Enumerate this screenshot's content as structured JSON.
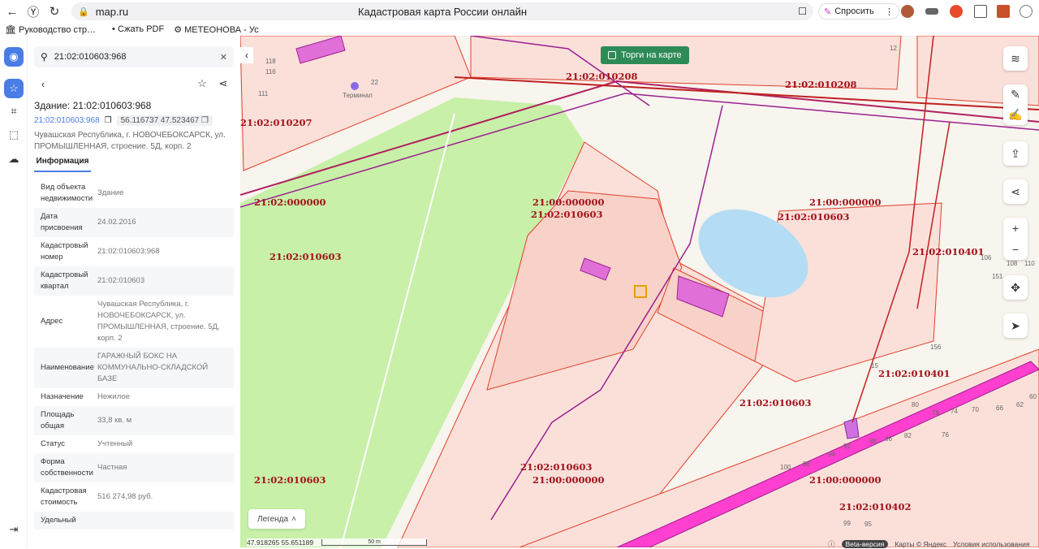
{
  "browser": {
    "url": "map.ru",
    "title": "Кадастровая карта России онлайн",
    "ask_label": "Спросить",
    "bookmarks": [
      "Руководство стр…",
      "Сжать PDF",
      "МЕТЕОНОВА - Ус"
    ]
  },
  "search": {
    "value": "21:02:010603:968"
  },
  "object": {
    "title": "Здание: 21:02:010603:968",
    "cad_link": "21:02:010603:968",
    "coords": "56.116737 47.523467",
    "address": "Чувашская Республика, г. НОВОЧЕБОКСАРСК, ул. ПРОМЫШЛЕННАЯ, строение. 5Д, корп. 2"
  },
  "tabs": [
    {
      "label": "Информация",
      "active": true
    }
  ],
  "info": [
    {
      "k": "Вид объекта недвижимости",
      "v": "Здание"
    },
    {
      "k": "Дата присвоения",
      "v": "24.02.2016"
    },
    {
      "k": "Кадастровый номер",
      "v": "21:02:010603:968"
    },
    {
      "k": "Кадастровый квартал",
      "v": "21:02:010603"
    },
    {
      "k": "Адрес",
      "v": "Чувашская Республика, г. НОВОЧЕБОКСАРСК, ул. ПРОМЫШЛЕННАЯ, строение. 5Д, корп. 2"
    },
    {
      "k": "Наименование",
      "v": "ГАРАЖНЫЙ БОКС НА КОММУНАЛЬНО-СКЛАДСКОЙ БАЗЕ"
    },
    {
      "k": "Назначение",
      "v": "Нежилое"
    },
    {
      "k": "Площадь общая",
      "v": "33,8  кв. м"
    },
    {
      "k": "Статус",
      "v": "Учтенный"
    },
    {
      "k": "Форма собственности",
      "v": "Частная"
    },
    {
      "k": "Кадастровая стоимость",
      "v": "516 274,98 руб."
    },
    {
      "k": "Удельный",
      "v": ""
    }
  ],
  "map": {
    "torgi_label": "Торги на карте",
    "legend_label": "Легенда",
    "cursor_coords": "47.918265  55.651189",
    "scale_label": "50 m",
    "beta_label": "Beta-версия",
    "attribution": "Карты © Яндекс",
    "terms": "Условия использования",
    "poi": "Терминал",
    "labels": [
      "21:02:010208",
      "21:02:010208",
      "21:02:010207",
      "21:02:000000",
      "21:00:000000",
      "21:02:010603",
      "21:00:000000",
      "21:02:010603",
      "21:02:010603",
      "21:02:010401",
      "21:02:010401",
      "21:02:010603",
      "21:02:010603",
      "21:00:000000",
      "21:02:010603",
      "21:00:000000",
      "21:02:010402"
    ],
    "house_numbers": [
      "118",
      "116",
      "111",
      "22",
      "12",
      "108",
      "110",
      "106",
      "151",
      "156",
      "15",
      "80",
      "78",
      "74",
      "70",
      "66",
      "62",
      "60",
      "82",
      "76",
      "88",
      "86",
      "92",
      "94",
      "98",
      "100",
      "95",
      "99"
    ]
  },
  "colors": {
    "accent": "#4a7ce6",
    "parcel_line": "#e0402a",
    "highlight": "#e060d0",
    "quarter_label": "#a0121a"
  }
}
